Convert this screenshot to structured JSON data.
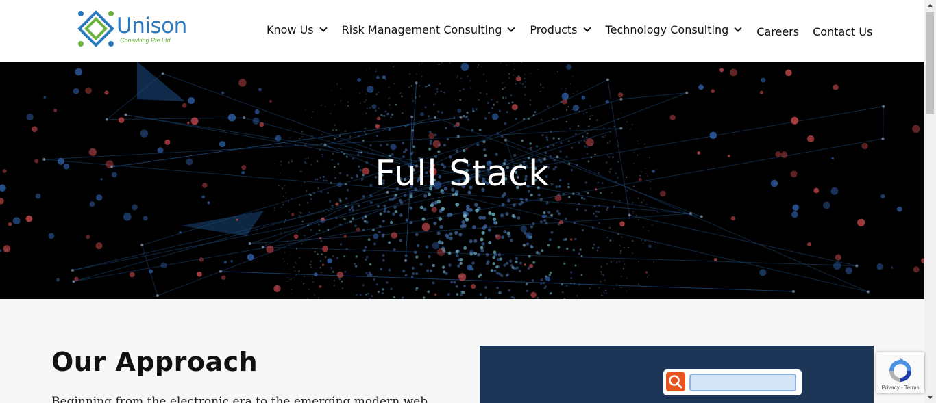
{
  "brand": {
    "name": "Unison",
    "tagline": "Consulting Pte Ltd",
    "colors": {
      "blue": "#2a78bd",
      "green": "#6cb33f"
    }
  },
  "nav": {
    "items": [
      {
        "label": "Know Us",
        "dropdown": true
      },
      {
        "label": "Risk Management Consulting",
        "dropdown": true
      },
      {
        "label": "Products",
        "dropdown": true
      },
      {
        "label": "Technology Consulting",
        "dropdown": true
      },
      {
        "label": "Careers",
        "dropdown": false
      },
      {
        "label": "Contact Us",
        "dropdown": false
      }
    ]
  },
  "hero": {
    "title": "Full Stack",
    "background_color": "#000000"
  },
  "content": {
    "heading": "Our Approach",
    "paragraph": "Beginning from the electronic era to the emerging modern web"
  },
  "recaptcha": {
    "privacy": "Privacy",
    "separator": "-",
    "terms": "Terms"
  },
  "icons": {
    "nav_dropdown": "chevron-down-icon",
    "search": "search-icon",
    "recaptcha": "recaptcha-icon"
  }
}
